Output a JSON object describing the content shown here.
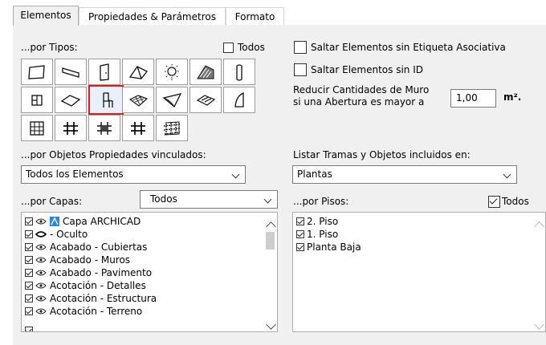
{
  "tabs": [
    {
      "label": "Elementos",
      "active": true
    },
    {
      "label": "Propiedades & Parámetros",
      "active": false
    },
    {
      "label": "Formato",
      "active": false
    }
  ],
  "by_types": {
    "label": "...por Tipos:",
    "all_label": "Todos",
    "all_checked": false,
    "selected_tool": "object-tool-icon",
    "tools_row1": [
      "slab-tool-icon",
      "beam-tool-icon",
      "door-tool-icon",
      "roof-tool-icon",
      "lamp-tool-icon",
      "mesh-tool-icon",
      "column-tool-icon"
    ],
    "tools_row2": [
      "zone-tool-icon",
      "skylight-tool-icon",
      "object-tool-icon",
      "morph-tool-icon",
      "shell-tool-icon",
      "stair-tool-icon",
      "window-tool-icon"
    ],
    "tools_row3": [
      "curtain-wall-tool-icon",
      "railing-tool-icon",
      "frame-tool-icon",
      "panel-tool-icon",
      "accessory-tool-icon"
    ]
  },
  "options": {
    "skip_no_label": "Saltar Elementos sin Etiqueta Asociativa",
    "skip_no_id": "Saltar Elementos sin ID",
    "reduce_line1": "Reducir Cantidades de Muro",
    "reduce_line2": "si una Abertura es mayor a",
    "reduce_value": "1,00",
    "reduce_unit": "m²."
  },
  "linked_props": {
    "label": "...por Objetos Propiedades vinculados:",
    "value": "Todos los Elementos"
  },
  "list_included": {
    "label": "Listar Tramas y Objetos incluidos en:",
    "value": "Plantas"
  },
  "layers": {
    "label": "...por Capas:",
    "filter_value": "Todos",
    "items": [
      {
        "name": "Capa ARCHICAD",
        "icon": "archicad-layer-icon"
      },
      {
        "name": "- Oculto",
        "icon": "hidden-eye-icon"
      },
      {
        "name": "Acabado - Cubiertas",
        "icon": "eye-icon"
      },
      {
        "name": "Acabado - Muros",
        "icon": "eye-icon"
      },
      {
        "name": "Acabado - Pavimento",
        "icon": "eye-icon"
      },
      {
        "name": "Acotación - Detalles",
        "icon": "eye-icon"
      },
      {
        "name": "Acotación - Estructura",
        "icon": "eye-icon"
      },
      {
        "name": "Acotación - Terreno",
        "icon": "eye-icon"
      }
    ]
  },
  "stories": {
    "label": "...por Pisos:",
    "all_label": "Todos",
    "all_checked": true,
    "items": [
      "2. Piso",
      "1. Piso",
      "Planta Baja"
    ]
  }
}
